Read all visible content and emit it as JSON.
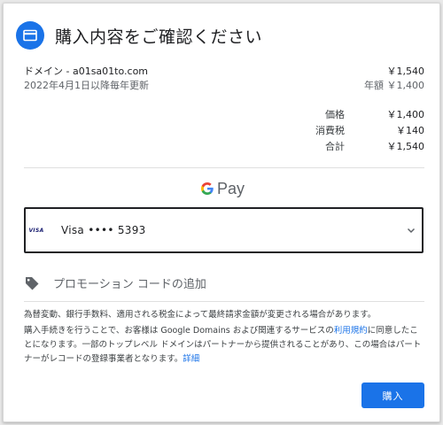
{
  "header": {
    "title": "購入内容をご確認ください",
    "icon": "credit-card-icon",
    "accent": "#1a73e8"
  },
  "domain": {
    "name": "ドメイン - a01sa01to.com",
    "price": "￥1,540",
    "renewal": "2022年4月1日以降毎年更新",
    "annual": "年額 ￥1,400"
  },
  "prices": [
    {
      "label": "価格",
      "value": "￥1,400"
    },
    {
      "label": "消費税",
      "value": "￥140"
    },
    {
      "label": "合計",
      "value": "￥1,540"
    }
  ],
  "payment": {
    "brand_g": "G",
    "brand_pay": "Pay",
    "card_brand": "VISA",
    "card_label": "Visa •••• 5393"
  },
  "promo": {
    "label": "プロモーション コードの追加"
  },
  "notes": {
    "exchange": "為替変動、銀行手数料、適用される税金によって最終請求金額が変更される場合があります。",
    "terms_prefix": "購入手続きを行うことで、お客様は Google Domains および関連するサービスの",
    "terms_link": "利用規約",
    "terms_suffix": "に同意したことになります。一部のトップレベル ドメインはパートナーから提供されることがあり、この場合はパートナーがレコードの登録事業者となります。",
    "details_link": "詳細"
  },
  "actions": {
    "buy_label": "購入"
  }
}
